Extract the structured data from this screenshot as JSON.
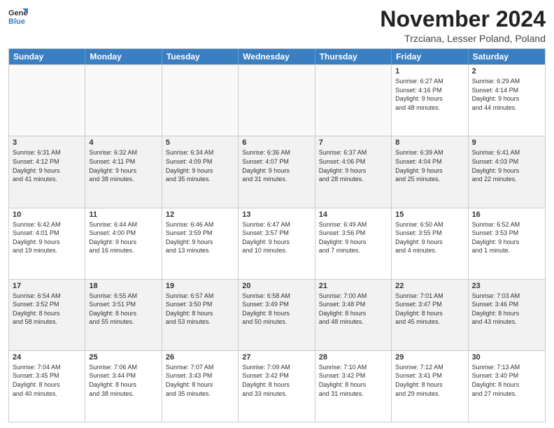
{
  "logo": {
    "general": "General",
    "blue": "Blue"
  },
  "title": "November 2024",
  "location": "Trzciana, Lesser Poland, Poland",
  "days": [
    "Sunday",
    "Monday",
    "Tuesday",
    "Wednesday",
    "Thursday",
    "Friday",
    "Saturday"
  ],
  "weeks": [
    [
      {
        "day": "",
        "info": ""
      },
      {
        "day": "",
        "info": ""
      },
      {
        "day": "",
        "info": ""
      },
      {
        "day": "",
        "info": ""
      },
      {
        "day": "",
        "info": ""
      },
      {
        "day": "1",
        "info": "Sunrise: 6:27 AM\nSunset: 4:16 PM\nDaylight: 9 hours\nand 48 minutes."
      },
      {
        "day": "2",
        "info": "Sunrise: 6:29 AM\nSunset: 4:14 PM\nDaylight: 9 hours\nand 44 minutes."
      }
    ],
    [
      {
        "day": "3",
        "info": "Sunrise: 6:31 AM\nSunset: 4:12 PM\nDaylight: 9 hours\nand 41 minutes."
      },
      {
        "day": "4",
        "info": "Sunrise: 6:32 AM\nSunset: 4:11 PM\nDaylight: 9 hours\nand 38 minutes."
      },
      {
        "day": "5",
        "info": "Sunrise: 6:34 AM\nSunset: 4:09 PM\nDaylight: 9 hours\nand 35 minutes."
      },
      {
        "day": "6",
        "info": "Sunrise: 6:36 AM\nSunset: 4:07 PM\nDaylight: 9 hours\nand 31 minutes."
      },
      {
        "day": "7",
        "info": "Sunrise: 6:37 AM\nSunset: 4:06 PM\nDaylight: 9 hours\nand 28 minutes."
      },
      {
        "day": "8",
        "info": "Sunrise: 6:39 AM\nSunset: 4:04 PM\nDaylight: 9 hours\nand 25 minutes."
      },
      {
        "day": "9",
        "info": "Sunrise: 6:41 AM\nSunset: 4:03 PM\nDaylight: 9 hours\nand 22 minutes."
      }
    ],
    [
      {
        "day": "10",
        "info": "Sunrise: 6:42 AM\nSunset: 4:01 PM\nDaylight: 9 hours\nand 19 minutes."
      },
      {
        "day": "11",
        "info": "Sunrise: 6:44 AM\nSunset: 4:00 PM\nDaylight: 9 hours\nand 16 minutes."
      },
      {
        "day": "12",
        "info": "Sunrise: 6:46 AM\nSunset: 3:59 PM\nDaylight: 9 hours\nand 13 minutes."
      },
      {
        "day": "13",
        "info": "Sunrise: 6:47 AM\nSunset: 3:57 PM\nDaylight: 9 hours\nand 10 minutes."
      },
      {
        "day": "14",
        "info": "Sunrise: 6:49 AM\nSunset: 3:56 PM\nDaylight: 9 hours\nand 7 minutes."
      },
      {
        "day": "15",
        "info": "Sunrise: 6:50 AM\nSunset: 3:55 PM\nDaylight: 9 hours\nand 4 minutes."
      },
      {
        "day": "16",
        "info": "Sunrise: 6:52 AM\nSunset: 3:53 PM\nDaylight: 9 hours\nand 1 minute."
      }
    ],
    [
      {
        "day": "17",
        "info": "Sunrise: 6:54 AM\nSunset: 3:52 PM\nDaylight: 8 hours\nand 58 minutes."
      },
      {
        "day": "18",
        "info": "Sunrise: 6:55 AM\nSunset: 3:51 PM\nDaylight: 8 hours\nand 55 minutes."
      },
      {
        "day": "19",
        "info": "Sunrise: 6:57 AM\nSunset: 3:50 PM\nDaylight: 8 hours\nand 53 minutes."
      },
      {
        "day": "20",
        "info": "Sunrise: 6:58 AM\nSunset: 3:49 PM\nDaylight: 8 hours\nand 50 minutes."
      },
      {
        "day": "21",
        "info": "Sunrise: 7:00 AM\nSunset: 3:48 PM\nDaylight: 8 hours\nand 48 minutes."
      },
      {
        "day": "22",
        "info": "Sunrise: 7:01 AM\nSunset: 3:47 PM\nDaylight: 8 hours\nand 45 minutes."
      },
      {
        "day": "23",
        "info": "Sunrise: 7:03 AM\nSunset: 3:46 PM\nDaylight: 8 hours\nand 43 minutes."
      }
    ],
    [
      {
        "day": "24",
        "info": "Sunrise: 7:04 AM\nSunset: 3:45 PM\nDaylight: 8 hours\nand 40 minutes."
      },
      {
        "day": "25",
        "info": "Sunrise: 7:06 AM\nSunset: 3:44 PM\nDaylight: 8 hours\nand 38 minutes."
      },
      {
        "day": "26",
        "info": "Sunrise: 7:07 AM\nSunset: 3:43 PM\nDaylight: 8 hours\nand 35 minutes."
      },
      {
        "day": "27",
        "info": "Sunrise: 7:09 AM\nSunset: 3:42 PM\nDaylight: 8 hours\nand 33 minutes."
      },
      {
        "day": "28",
        "info": "Sunrise: 7:10 AM\nSunset: 3:42 PM\nDaylight: 8 hours\nand 31 minutes."
      },
      {
        "day": "29",
        "info": "Sunrise: 7:12 AM\nSunset: 3:41 PM\nDaylight: 8 hours\nand 29 minutes."
      },
      {
        "day": "30",
        "info": "Sunrise: 7:13 AM\nSunset: 3:40 PM\nDaylight: 8 hours\nand 27 minutes."
      }
    ]
  ]
}
